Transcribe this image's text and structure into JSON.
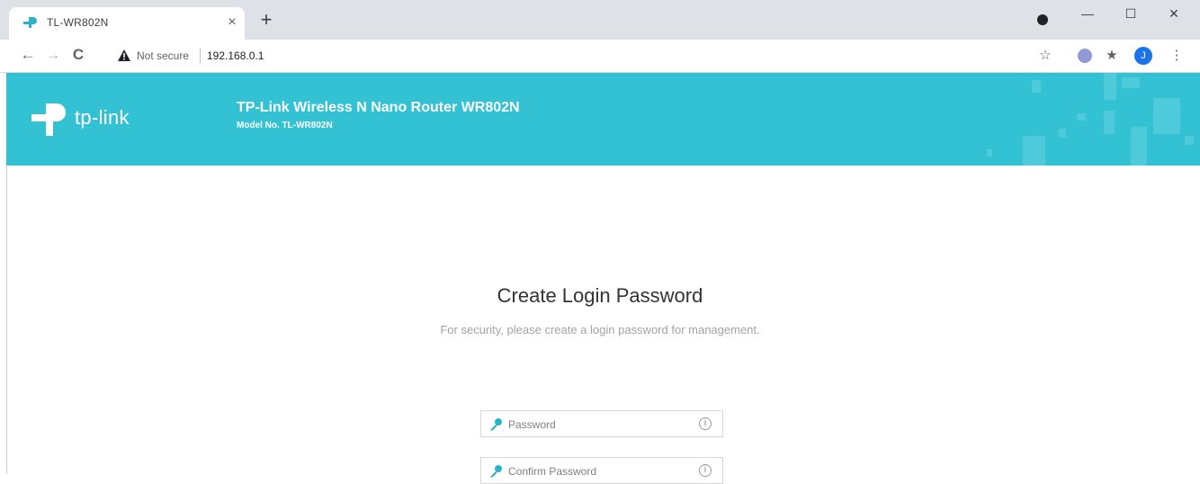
{
  "browser": {
    "tab_title": "TL-WR802N",
    "tab_close": "×",
    "new_tab": "+",
    "security_label": "Not secure",
    "url": "192.168.0.1",
    "back_icon": "←",
    "forward_icon": "→",
    "reload_icon": "C",
    "star_icon": "☆",
    "puzzle_icon": "★",
    "menu_icon": "⋮",
    "avatar_letter": "J",
    "minimize": "—",
    "maximize": "☐",
    "close": "✕"
  },
  "header": {
    "logo_text": "tp-link",
    "product_name": "TP-Link Wireless N Nano Router WR802N",
    "model_no": "Model No. TL-WR802N"
  },
  "login": {
    "title": "Create Login Password",
    "subtitle": "For security, please create a login password for management.",
    "password_placeholder": "Password",
    "confirm_placeholder": "Confirm Password",
    "info_icon": "i"
  },
  "colors": {
    "header_bg": "#33c1d4",
    "key_icon": "#2bb3c5",
    "avatar": "#1a73e8"
  }
}
